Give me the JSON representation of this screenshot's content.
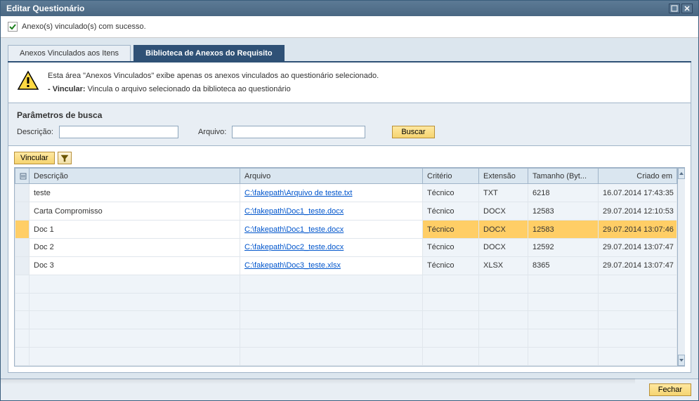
{
  "window": {
    "title": "Editar Questionário"
  },
  "message": "Anexo(s) vinculado(s) com sucesso.",
  "tabs": {
    "linked": "Anexos Vinculados aos Itens",
    "library": "Biblioteca de Anexos do Requisito"
  },
  "info": {
    "line1": "Esta área \"Anexos Vinculados\" exibe apenas os anexos vinculados ao questionário selecionado.",
    "line2_label": "- Vincular:",
    "line2_text": "Vincula o arquivo selecionado da biblioteca ao questionário"
  },
  "search": {
    "title": "Parâmetros de busca",
    "desc_label": "Descrição:",
    "arq_label": "Arquivo:",
    "buscar": "Buscar"
  },
  "toolbar": {
    "vincular": "Vincular"
  },
  "columns": {
    "desc": "Descrição",
    "arq": "Arquivo",
    "crit": "Critério",
    "ext": "Extensão",
    "tam": "Tamanho (Byt...",
    "date": "Criado em"
  },
  "rows": [
    {
      "desc": "teste",
      "arq": "C:\\fakepath\\Arquivo de teste.txt",
      "crit": "Técnico",
      "ext": "TXT",
      "tam": "6218",
      "date": "16.07.2014 17:43:35",
      "selected": false
    },
    {
      "desc": "Carta Compromisso",
      "arq": "C:\\fakepath\\Doc1_teste.docx",
      "crit": "Técnico",
      "ext": "DOCX",
      "tam": "12583",
      "date": "29.07.2014 12:10:53",
      "selected": false
    },
    {
      "desc": "Doc 1",
      "arq": "C:\\fakepath\\Doc1_teste.docx",
      "crit": "Técnico",
      "ext": "DOCX",
      "tam": "12583",
      "date": "29.07.2014 13:07:46",
      "selected": true
    },
    {
      "desc": "Doc 2",
      "arq": "C:\\fakepath\\Doc2_teste.docx",
      "crit": "Técnico",
      "ext": "DOCX",
      "tam": "12592",
      "date": "29.07.2014 13:07:47",
      "selected": false
    },
    {
      "desc": "Doc 3",
      "arq": "C:\\fakepath\\Doc3_teste.xlsx",
      "crit": "Técnico",
      "ext": "XLSX",
      "tam": "8365",
      "date": "29.07.2014 13:07:47",
      "selected": false
    }
  ],
  "footer": {
    "fechar": "Fechar"
  }
}
